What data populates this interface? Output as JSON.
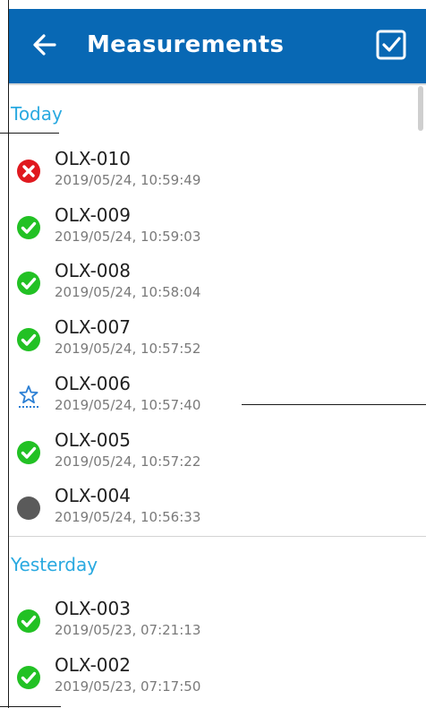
{
  "appbar": {
    "title": "Measurements",
    "back_icon": "arrow-left-icon",
    "action_icon": "checkbox-checked-icon",
    "background_color": "#0868b4"
  },
  "colors": {
    "accent": "#29a9e0",
    "status_ok": "#22c124",
    "status_error": "#e0191f",
    "status_pending": "#5a5a5a",
    "status_reference": "#2b7fd4"
  },
  "sections": [
    {
      "header": "Today",
      "items": [
        {
          "name": "OLX-010",
          "date": "2019/05/24, 10:59:49",
          "status": "error"
        },
        {
          "name": "OLX-009",
          "date": "2019/05/24, 10:59:03",
          "status": "ok"
        },
        {
          "name": "OLX-008",
          "date": "2019/05/24, 10:58:04",
          "status": "ok"
        },
        {
          "name": "OLX-007",
          "date": "2019/05/24, 10:57:52",
          "status": "ok"
        },
        {
          "name": "OLX-006",
          "date": "2019/05/24, 10:57:40",
          "status": "reference"
        },
        {
          "name": "OLX-005",
          "date": "2019/05/24, 10:57:22",
          "status": "ok"
        },
        {
          "name": "OLX-004",
          "date": "2019/05/24, 10:56:33",
          "status": "pending"
        }
      ]
    },
    {
      "header": "Yesterday",
      "items": [
        {
          "name": "OLX-003",
          "date": "2019/05/23, 07:21:13",
          "status": "ok"
        },
        {
          "name": "OLX-002",
          "date": "2019/05/23, 07:17:50",
          "status": "ok"
        }
      ]
    }
  ]
}
